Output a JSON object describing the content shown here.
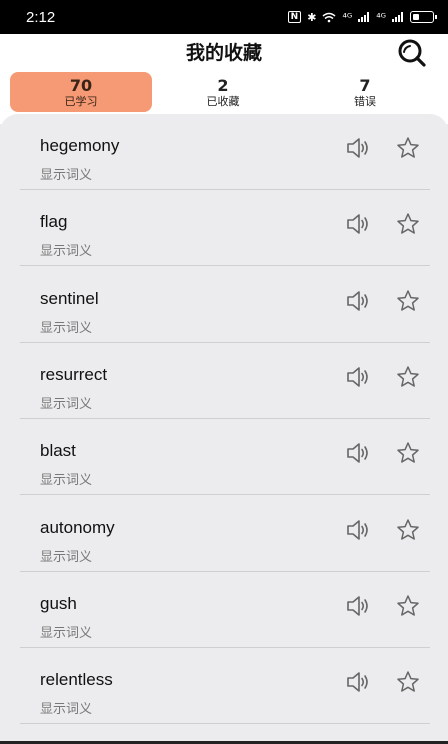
{
  "status_bar": {
    "time": "2:12",
    "nfc": "N",
    "bluetooth": "✱",
    "signal1": "⁴ᴳ",
    "signal2": "⁴ᴳ"
  },
  "header": {
    "title": "我的收藏",
    "search_icon": "search-icon"
  },
  "tabs": [
    {
      "count": "70",
      "label": "已学习",
      "active": true
    },
    {
      "count": "2",
      "label": "已收藏",
      "active": false
    },
    {
      "count": "7",
      "label": "错误",
      "active": false
    }
  ],
  "words": [
    {
      "word": "hegemony",
      "hint": "显示词义"
    },
    {
      "word": "flag",
      "hint": "显示词义"
    },
    {
      "word": "sentinel",
      "hint": "显示词义"
    },
    {
      "word": "resurrect",
      "hint": "显示词义"
    },
    {
      "word": "blast",
      "hint": "显示词义"
    },
    {
      "word": "autonomy",
      "hint": "显示词义"
    },
    {
      "word": "gush",
      "hint": "显示词义"
    },
    {
      "word": "relentless",
      "hint": "显示词义"
    }
  ],
  "colors": {
    "active_tab": "#f59a74",
    "panel_bg": "#ececee",
    "divider": "#cfcfd3"
  }
}
